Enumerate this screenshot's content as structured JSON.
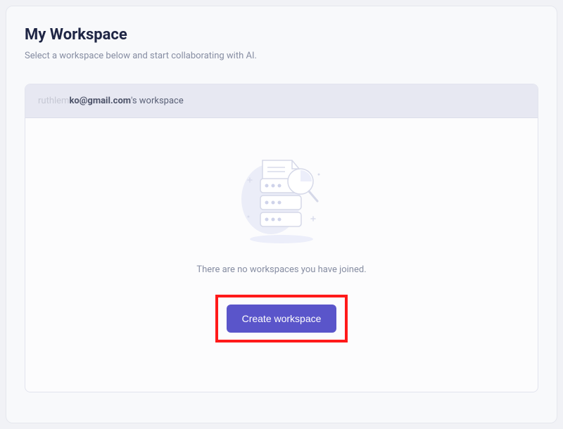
{
  "header": {
    "title": "My Workspace",
    "subtitle": "Select a workspace below and start collaborating with AI."
  },
  "panel": {
    "ownerFaded": "ruthlem",
    "ownerBold": "ko@gmail.com",
    "ownerSuffix": "'s workspace"
  },
  "emptyState": {
    "message": "There are no workspaces you have joined.",
    "createButtonLabel": "Create workspace"
  },
  "illustration": {
    "name": "empty-workspace-illustration"
  },
  "colors": {
    "primary": "#5a55ca",
    "highlight": "#ff1a1a"
  }
}
